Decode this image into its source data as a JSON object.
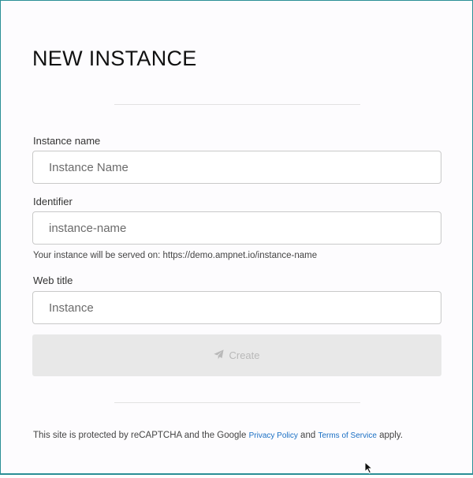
{
  "page": {
    "title": "NEW INSTANCE"
  },
  "form": {
    "instance_name": {
      "label": "Instance name",
      "placeholder": "Instance Name"
    },
    "identifier": {
      "label": "Identifier",
      "placeholder": "instance-name",
      "hint": "Your instance will be served on: https://demo.ampnet.io/instance-name"
    },
    "web_title": {
      "label": "Web title",
      "placeholder": "Instance"
    },
    "create_button": {
      "label": "Create",
      "icon": "paper-plane-icon",
      "disabled": true
    }
  },
  "footer": {
    "prefix": "This site is protected by reCAPTCHA and the Google",
    "privacy_link": "Privacy Policy",
    "and": "and",
    "terms_link": "Terms of Service",
    "suffix": "apply."
  },
  "colors": {
    "frame_border": "#2a8f96",
    "button_disabled_bg": "#e8e8e8",
    "link": "#1a6fc4"
  }
}
